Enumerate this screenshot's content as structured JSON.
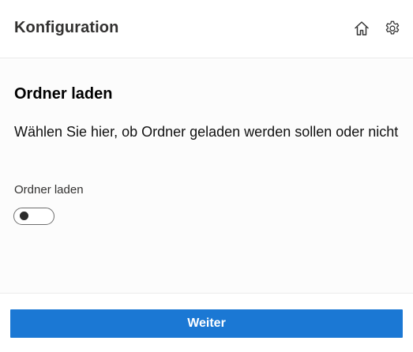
{
  "header": {
    "title": "Konfiguration",
    "icons": [
      "home-icon",
      "gear-icon"
    ]
  },
  "main": {
    "title": "Ordner laden",
    "description": "Wählen Sie hier, ob Ordner geladen werden sollen oder nicht",
    "toggle": {
      "label": "Ordner laden",
      "checked": false
    }
  },
  "footer": {
    "button_label": "Weiter"
  },
  "colors": {
    "accent": "#1b78d4",
    "text": "#1f1f1f"
  }
}
